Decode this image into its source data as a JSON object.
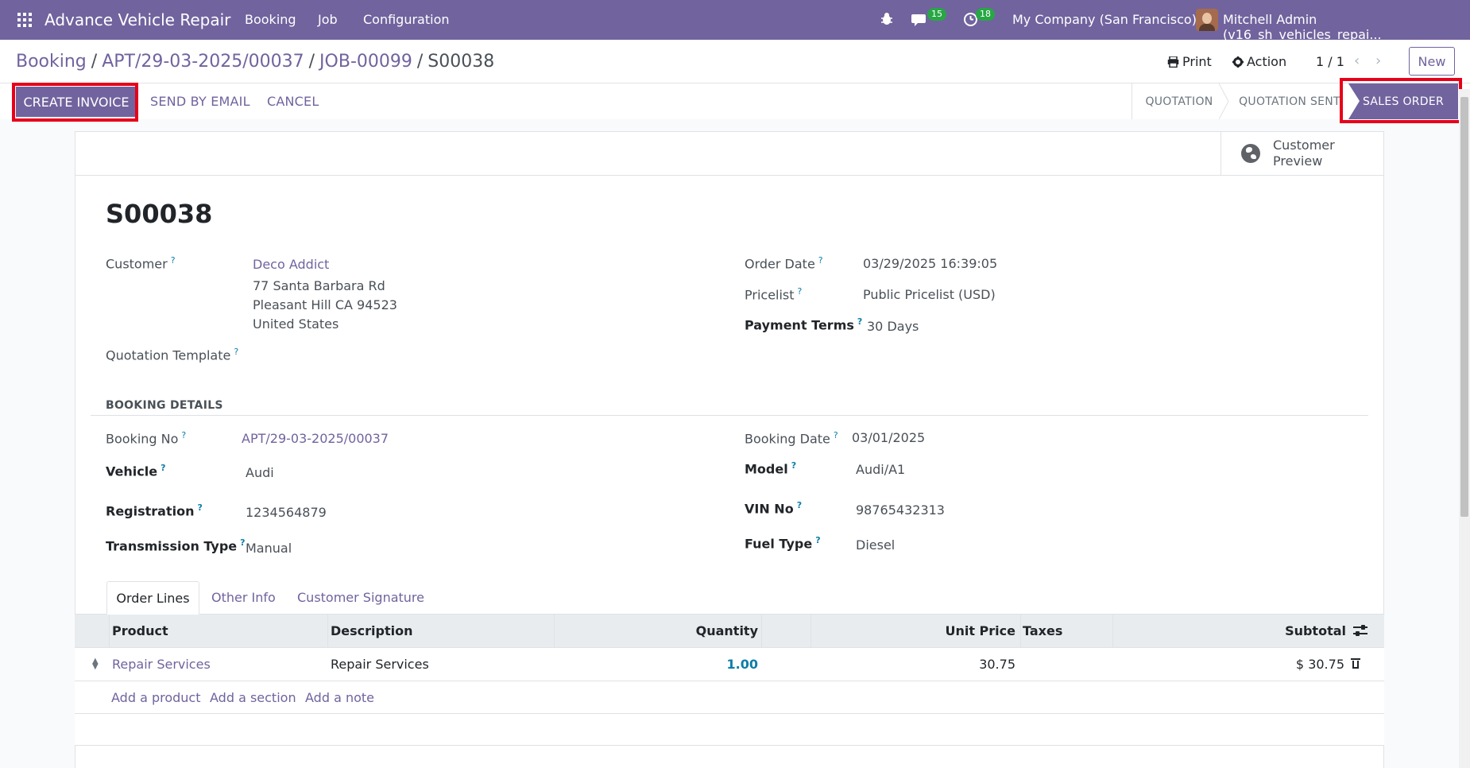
{
  "navbar": {
    "brand": "Advance Vehicle Repair",
    "menu": [
      "Booking",
      "Job",
      "Configuration"
    ],
    "messages_count": "15",
    "activities_count": "18",
    "company": "My Company (San Francisco)",
    "user": "Mitchell Admin (v16_sh_vehicles_repai..."
  },
  "breadcrumb": {
    "items": [
      "Booking",
      "APT/29-03-2025/00037",
      "JOB-00099"
    ],
    "current": "S00038"
  },
  "control": {
    "print_label": "Print",
    "action_label": "Action",
    "pager": "1 / 1",
    "new_label": "New"
  },
  "actions": {
    "create_invoice": "CREATE INVOICE",
    "send_by_email": "SEND BY EMAIL",
    "cancel": "CANCEL"
  },
  "statusbar": {
    "stages": [
      "QUOTATION",
      "QUOTATION SENT",
      "SALES ORDER"
    ],
    "active": "SALES ORDER"
  },
  "stat_button": {
    "line1": "Customer",
    "line2": "Preview"
  },
  "order": {
    "name": "S00038",
    "customer_label": "Customer",
    "customer_name": "Deco Addict",
    "customer_address": [
      "77 Santa Barbara Rd",
      "Pleasant Hill CA 94523",
      "United States"
    ],
    "quotation_template_label": "Quotation Template",
    "order_date_label": "Order Date",
    "order_date": "03/29/2025 16:39:05",
    "pricelist_label": "Pricelist",
    "pricelist": "Public Pricelist (USD)",
    "payment_terms_label": "Payment Terms",
    "payment_terms": "30 Days"
  },
  "booking": {
    "section_title": "BOOKING DETAILS",
    "booking_no_label": "Booking No",
    "booking_no": "APT/29-03-2025/00037",
    "vehicle_label": "Vehicle",
    "vehicle": "Audi",
    "registration_label": "Registration",
    "registration": "1234564879",
    "transmission_label": "Transmission Type",
    "transmission": "Manual",
    "booking_date_label": "Booking Date",
    "booking_date": "03/01/2025",
    "model_label": "Model",
    "model": "Audi/A1",
    "vin_label": "VIN No",
    "vin": "98765432313",
    "fuel_label": "Fuel Type",
    "fuel": "Diesel"
  },
  "tabs": [
    "Order Lines",
    "Other Info",
    "Customer Signature"
  ],
  "table": {
    "headers": [
      "Product",
      "Description",
      "Quantity",
      "Unit Price",
      "Taxes",
      "Subtotal"
    ],
    "rows": [
      {
        "product": "Repair Services",
        "description": "Repair Services",
        "quantity": "1.00",
        "unit_price": "30.75",
        "taxes": "",
        "subtotal": "$ 30.75"
      }
    ],
    "add_links": [
      "Add a product",
      "Add a section",
      "Add a note"
    ]
  },
  "help_mark": "?"
}
